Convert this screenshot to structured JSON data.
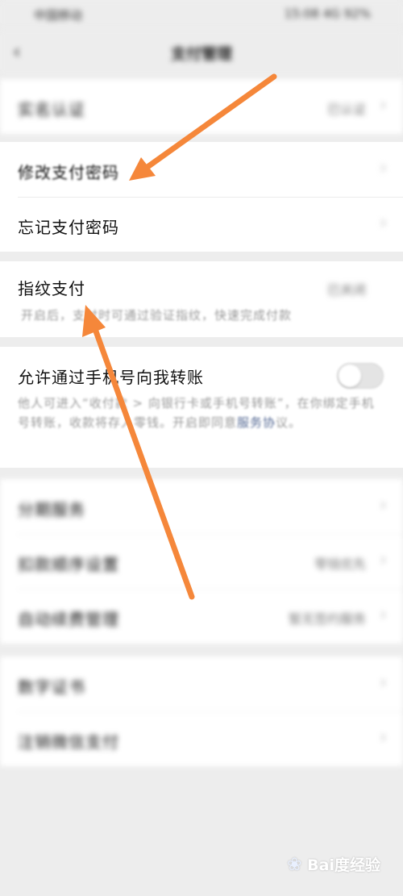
{
  "status_bar": {
    "carrier": "中国移动",
    "right": "15:08 4G 92%"
  },
  "nav": {
    "back_icon": "chevron-left-icon",
    "title": "支付管理"
  },
  "group1": {
    "label": "实名认证",
    "value": "已认证"
  },
  "group2": {
    "items": [
      {
        "label": "修改支付密码"
      },
      {
        "label": "忘记支付密码"
      }
    ]
  },
  "group3": {
    "label": "指纹支付",
    "value": "已关闭",
    "subtitle": "开启后，支付时可通过验证指纹，快速完成付款"
  },
  "group4": {
    "label": "允许通过手机号向我转账",
    "toggle_on": false,
    "desc_prefix": "他人可进入“收付款 > 向银行卡或手机号转账”，在你绑定手机号转账，收款将存入零钱。开启即同意",
    "desc_link": "服务协",
    "desc_suffix": "议。"
  },
  "group5": {
    "items": [
      {
        "label": "分期服务",
        "value": ""
      },
      {
        "label": "扣款顺序设置",
        "value": "零钱优先"
      },
      {
        "label": "自动续费管理",
        "value": "暂无签约服务"
      }
    ]
  },
  "group6": {
    "items": [
      {
        "label": "数字证书"
      },
      {
        "label": "注销微信支付"
      }
    ]
  },
  "watermark": {
    "text": "Bai度经验"
  },
  "colors": {
    "arrow": "#f5873a",
    "link": "#576b95",
    "background": "#ededed"
  }
}
